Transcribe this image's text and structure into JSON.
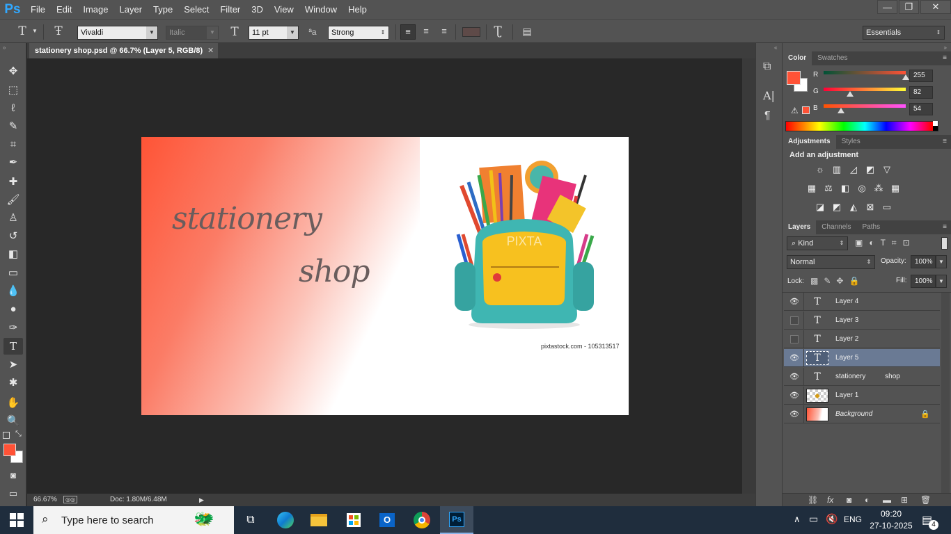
{
  "app": {
    "logo": "Ps"
  },
  "menu": [
    "File",
    "Edit",
    "Image",
    "Layer",
    "Type",
    "Select",
    "Filter",
    "3D",
    "View",
    "Window",
    "Help"
  ],
  "window_controls": {
    "minimize": "—",
    "restore": "❐",
    "close": "✕"
  },
  "options": {
    "font_family": "Vivaldi",
    "font_style": "Italic",
    "font_size": "11 pt",
    "antialias_label": "ªa",
    "antialias": "Strong",
    "workspace": "Essentials",
    "text_color": "#5e4a48"
  },
  "document": {
    "tab_title": "stationery shop.psd @ 66.7% (Layer 5, RGB/8)",
    "close": "✕",
    "canvas_text_1": "stationery",
    "canvas_text_2": "shop",
    "watermark": "pixtastock.com - 105313517",
    "image_brand": "PIXTA"
  },
  "status": {
    "zoom": "66.67%",
    "doc": "Doc: 1.80M/6.48M"
  },
  "color_panel": {
    "tabs": [
      "Color",
      "Swatches"
    ],
    "fg_color": "#ff5236",
    "channels": [
      {
        "label": "R",
        "value": "255",
        "level": 1.0
      },
      {
        "label": "G",
        "value": "82",
        "level": 0.32
      },
      {
        "label": "B",
        "value": "54",
        "level": 0.21
      }
    ]
  },
  "adjustments_panel": {
    "tabs": [
      "Adjustments",
      "Styles"
    ],
    "title": "Add an adjustment",
    "icons_row1": [
      "brightness-icon",
      "levels-icon",
      "curves-icon",
      "exposure-icon",
      "vibrance-icon"
    ],
    "icons_row2": [
      "hue-icon",
      "balance-icon",
      "bw-icon",
      "photo-filter-icon",
      "mixer-icon",
      "lookup-icon"
    ],
    "icons_row3": [
      "invert-icon",
      "posterize-icon",
      "threshold-icon",
      "selective-icon",
      "gradient-map-icon"
    ]
  },
  "layers_panel": {
    "tabs": [
      "Layers",
      "Channels",
      "Paths"
    ],
    "filter": "Kind",
    "blend_mode": "Normal",
    "opacity_label": "Opacity:",
    "opacity": "100%",
    "lock_label": "Lock:",
    "fill_label": "Fill:",
    "fill": "100%",
    "layers": [
      {
        "name": "Layer 4",
        "type": "text",
        "visible": true,
        "selected": false
      },
      {
        "name": "Layer 3",
        "type": "text",
        "visible": false,
        "selected": false
      },
      {
        "name": "Layer 2",
        "type": "text",
        "visible": false,
        "selected": false
      },
      {
        "name": "Layer 5",
        "type": "text",
        "visible": true,
        "selected": true
      },
      {
        "name": "stationery          shop",
        "type": "text",
        "visible": true,
        "selected": false
      },
      {
        "name": "Layer 1",
        "type": "image",
        "visible": true,
        "selected": false
      },
      {
        "name": "Background",
        "type": "background",
        "visible": true,
        "selected": false
      }
    ]
  },
  "taskbar": {
    "search_placeholder": "Type here to search",
    "language": "ENG",
    "time": "09:20",
    "date": "27-10-2025",
    "notifications": "4"
  }
}
